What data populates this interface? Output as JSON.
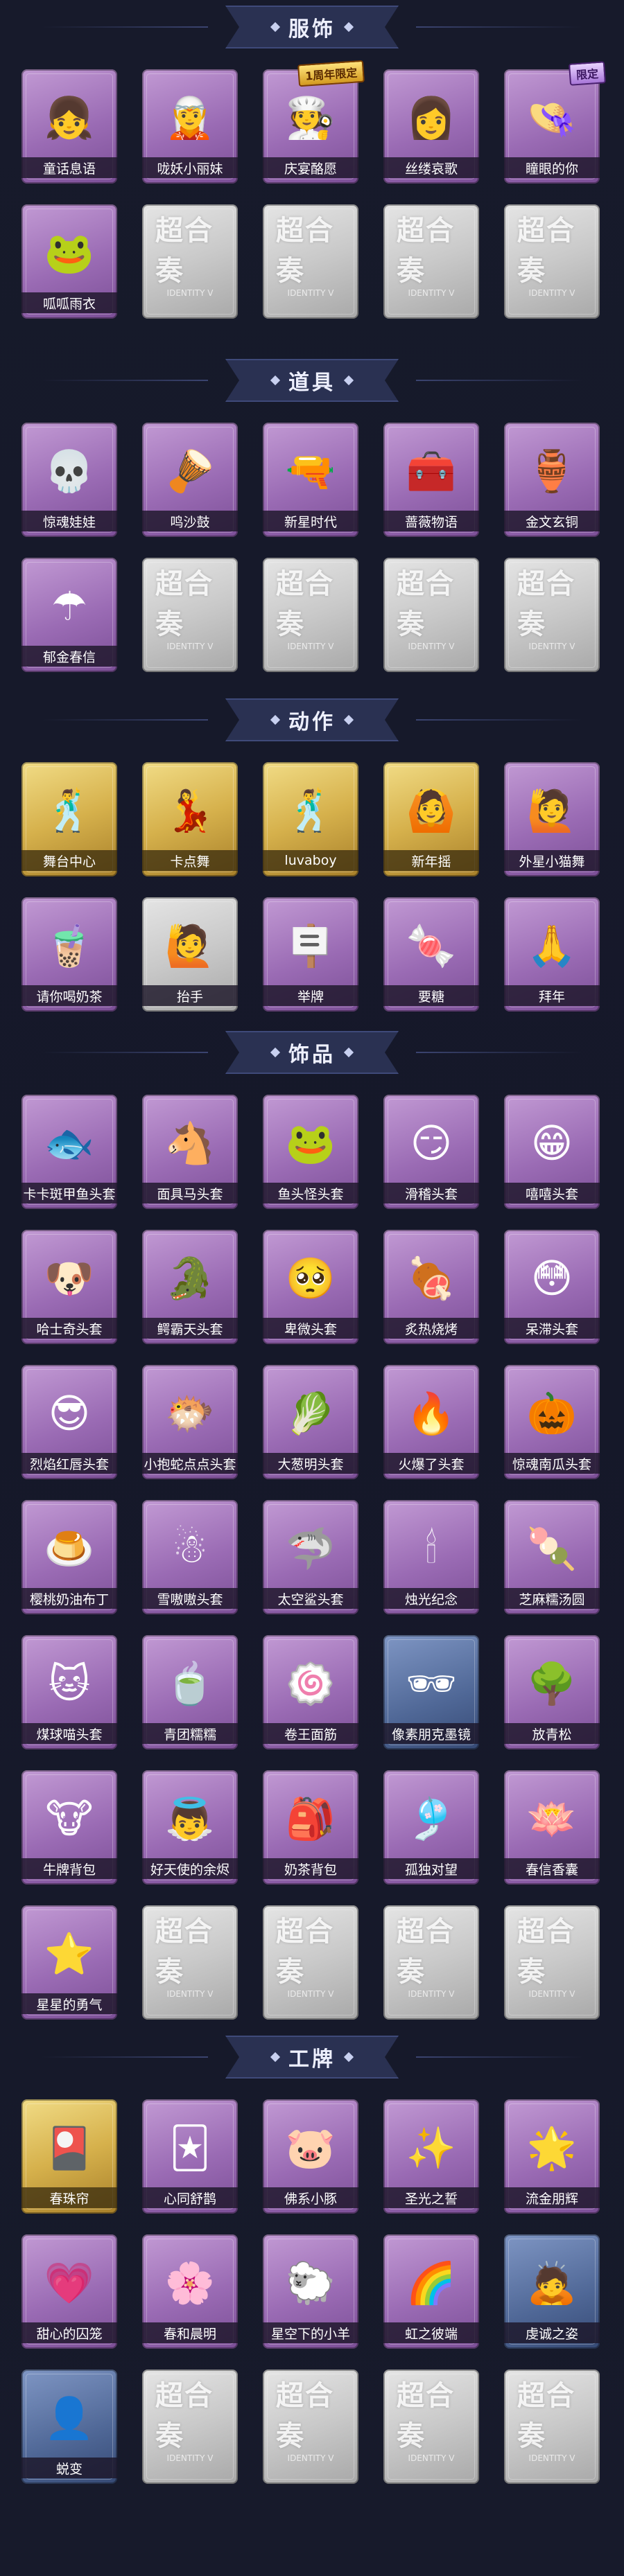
{
  "sections": [
    {
      "title": "服饰",
      "items": [
        {
          "label": "童话息语",
          "icon": "girl-avatar-icon",
          "style": "purple",
          "sym": "👧"
        },
        {
          "label": "咙妖小丽妹",
          "icon": "fox-girl-avatar-icon",
          "style": "purple",
          "sym": "🧝"
        },
        {
          "label": "庆宴酪愿",
          "icon": "chef-avatar-icon",
          "style": "purple",
          "sym": "🧑‍🍳",
          "tag": "1周年限定"
        },
        {
          "label": "丝缕哀歌",
          "icon": "lady-avatar-icon",
          "style": "purple",
          "sym": "👩"
        },
        {
          "label": "瞳眼的你",
          "icon": "hat-girl-avatar-icon",
          "style": "purple",
          "sym": "👒",
          "tag": "限定",
          "tagStyle": "purple"
        },
        {
          "label": "呱呱雨衣",
          "icon": "frog-raincoat-avatar-icon",
          "style": "purple",
          "sym": "🐸"
        },
        {
          "placeholder": true,
          "label": "超合奏",
          "sub": "IDENTITY V"
        },
        {
          "placeholder": true,
          "label": "超合奏",
          "sub": "IDENTITY V"
        },
        {
          "placeholder": true,
          "label": "超合奏",
          "sub": "IDENTITY V"
        },
        {
          "placeholder": true,
          "label": "超合奏",
          "sub": "IDENTITY V"
        }
      ]
    },
    {
      "title": "道具",
      "items": [
        {
          "label": "惊魂娃娃",
          "icon": "skull-doll-icon",
          "style": "purple",
          "sym": "💀"
        },
        {
          "label": "鸣沙鼓",
          "icon": "dreamcatcher-icon",
          "style": "purple",
          "sym": "🪘"
        },
        {
          "label": "新星时代",
          "icon": "pistol-icon",
          "style": "purple",
          "sym": "🔫"
        },
        {
          "label": "蔷薇物语",
          "icon": "medkit-icon",
          "style": "purple",
          "sym": "🧰"
        },
        {
          "label": "金文玄铜",
          "icon": "bronze-vessel-icon",
          "style": "purple",
          "sym": "🏺"
        },
        {
          "label": "郁金春信",
          "icon": "parasol-icon",
          "style": "purple",
          "sym": "☂"
        },
        {
          "placeholder": true,
          "label": "超合奏",
          "sub": "IDENTITY V"
        },
        {
          "placeholder": true,
          "label": "超合奏",
          "sub": "IDENTITY V"
        },
        {
          "placeholder": true,
          "label": "超合奏",
          "sub": "IDENTITY V"
        },
        {
          "placeholder": true,
          "label": "超合奏",
          "sub": "IDENTITY V"
        }
      ]
    },
    {
      "title": "动作",
      "items": [
        {
          "label": "舞台中心",
          "icon": "dance-pose-icon",
          "style": "gold",
          "sym": "🕺"
        },
        {
          "label": "卡点舞",
          "icon": "dance-pose-icon",
          "style": "gold",
          "sym": "💃"
        },
        {
          "label": "luvaboy",
          "icon": "dance-pose-icon",
          "style": "gold",
          "sym": "🕺"
        },
        {
          "label": "新年摇",
          "icon": "dance-pose-icon",
          "style": "gold",
          "sym": "🙆"
        },
        {
          "label": "外星小猫舞",
          "icon": "dance-pose-icon",
          "style": "purple",
          "sym": "🙋"
        },
        {
          "label": "请你喝奶茶",
          "icon": "bubble-tea-pose-icon",
          "style": "purple",
          "sym": "🧋"
        },
        {
          "label": "抬手",
          "icon": "raise-hand-pose-icon",
          "style": "grey",
          "sym": "🙋"
        },
        {
          "label": "举牌",
          "icon": "sign-pose-icon",
          "style": "purple",
          "sym": "🪧"
        },
        {
          "label": "要糖",
          "icon": "ask-candy-pose-icon",
          "style": "purple",
          "sym": "🍬"
        },
        {
          "label": "拜年",
          "icon": "greeting-pose-icon",
          "style": "purple",
          "sym": "🙏"
        }
      ]
    },
    {
      "title": "饰品",
      "items": [
        {
          "label": "卡卡斑甲鱼头套",
          "icon": "fish-head-icon",
          "style": "purple",
          "sym": "🐟"
        },
        {
          "label": "面具马头套",
          "icon": "horse-head-icon",
          "style": "purple",
          "sym": "🐴"
        },
        {
          "label": "鱼头怪头套",
          "icon": "fish-monster-head-icon",
          "style": "purple",
          "sym": "🐸"
        },
        {
          "label": "滑稽头套",
          "icon": "funny-face-icon",
          "style": "purple",
          "sym": "😏"
        },
        {
          "label": "嘻嘻头套",
          "icon": "grin-face-icon",
          "style": "purple",
          "sym": "😁"
        },
        {
          "label": "哈士奇头套",
          "icon": "husky-head-icon",
          "style": "purple",
          "sym": "🐶"
        },
        {
          "label": "鳄霸天头套",
          "icon": "crocodile-head-icon",
          "style": "purple",
          "sym": "🐊"
        },
        {
          "label": "卑微头套",
          "icon": "humble-face-icon",
          "style": "purple",
          "sym": "🥺"
        },
        {
          "label": "炙热烧烤",
          "icon": "bbq-meat-icon",
          "style": "purple",
          "sym": "🍖"
        },
        {
          "label": "呆滞头套",
          "icon": "dazed-face-icon",
          "style": "purple",
          "sym": "😳"
        },
        {
          "label": "烈焰红唇头套",
          "icon": "sunglasses-pikachu-icon",
          "style": "purple",
          "sym": "😎"
        },
        {
          "label": "小抱蛇点点头套",
          "icon": "pink-blob-icon",
          "style": "purple",
          "sym": "🐡"
        },
        {
          "label": "大葱明头套",
          "icon": "scallion-head-icon",
          "style": "purple",
          "sym": "🥬"
        },
        {
          "label": "火爆了头套",
          "icon": "fire-head-icon",
          "style": "purple",
          "sym": "🔥"
        },
        {
          "label": "惊魂南瓜头套",
          "icon": "pumpkin-head-icon",
          "style": "purple",
          "sym": "🎃"
        },
        {
          "label": "樱桃奶油布丁",
          "icon": "pudding-icon",
          "style": "purple",
          "sym": "🍮"
        },
        {
          "label": "雪嗷嗷头套",
          "icon": "snow-creature-icon",
          "style": "purple",
          "sym": "☃"
        },
        {
          "label": "太空鲨头套",
          "icon": "shark-head-icon",
          "style": "purple",
          "sym": "🦈"
        },
        {
          "label": "烛光纪念",
          "icon": "candle-icon",
          "style": "purple",
          "sym": "🕯"
        },
        {
          "label": "芝麻糯汤圆",
          "icon": "rice-ball-icon",
          "style": "purple",
          "sym": "🍡"
        },
        {
          "label": "煤球喵头套",
          "icon": "black-cat-head-icon",
          "style": "purple",
          "sym": "🐱"
        },
        {
          "label": "青团糯糯",
          "icon": "green-dumpling-icon",
          "style": "purple",
          "sym": "🍵"
        },
        {
          "label": "卷王面筋",
          "icon": "swiss-roll-icon",
          "style": "purple",
          "sym": "🍥"
        },
        {
          "label": "像素朋克墨镜",
          "icon": "pixel-sunglasses-icon",
          "style": "navy",
          "sym": "🕶"
        },
        {
          "label": "放青松",
          "icon": "bonsai-icon",
          "style": "purple",
          "sym": "🌳"
        },
        {
          "label": "牛牌背包",
          "icon": "cow-backpack-icon",
          "style": "purple",
          "sym": "🐮"
        },
        {
          "label": "好天使的余烬",
          "icon": "angel-doll-icon",
          "style": "purple",
          "sym": "👼"
        },
        {
          "label": "奶茶背包",
          "icon": "milktea-backpack-icon",
          "style": "purple",
          "sym": "🎒"
        },
        {
          "label": "孤独对望",
          "icon": "hanging-charm-icon",
          "style": "purple",
          "sym": "🎐"
        },
        {
          "label": "春信香囊",
          "icon": "sachet-icon",
          "style": "purple",
          "sym": "🪷"
        },
        {
          "label": "星星的勇气",
          "icon": "star-doll-icon",
          "style": "purple",
          "sym": "⭐"
        },
        {
          "placeholder": true,
          "label": "超合奏",
          "sub": "IDENTITY V"
        },
        {
          "placeholder": true,
          "label": "超合奏",
          "sub": "IDENTITY V"
        },
        {
          "placeholder": true,
          "label": "超合奏",
          "sub": "IDENTITY V"
        },
        {
          "placeholder": true,
          "label": "超合奏",
          "sub": "IDENTITY V"
        }
      ]
    },
    {
      "title": "工牌",
      "items": [
        {
          "label": "春珠帘",
          "icon": "badge-card-icon",
          "style": "gold",
          "sym": "🎴"
        },
        {
          "label": "心同舒鹊",
          "icon": "badge-card-icon",
          "style": "purple",
          "sym": "🃏"
        },
        {
          "label": "佛系小豚",
          "icon": "badge-card-icon",
          "style": "purple",
          "sym": "🐷"
        },
        {
          "label": "圣光之誓",
          "icon": "badge-card-icon",
          "style": "purple",
          "sym": "✨"
        },
        {
          "label": "流金朋辉",
          "icon": "badge-card-icon",
          "style": "purple",
          "sym": "🌟"
        },
        {
          "label": "甜心的囚笼",
          "icon": "badge-card-icon",
          "style": "purple",
          "sym": "💗"
        },
        {
          "label": "春和晨明",
          "icon": "badge-card-icon",
          "style": "purple",
          "sym": "🌸"
        },
        {
          "label": "星空下的小羊",
          "icon": "badge-card-icon",
          "style": "purple",
          "sym": "🐑"
        },
        {
          "label": "虹之彼端",
          "icon": "badge-card-icon",
          "style": "purple",
          "sym": "🌈"
        },
        {
          "label": "虔诚之姿",
          "icon": "badge-card-icon",
          "style": "navy",
          "sym": "🙇"
        },
        {
          "label": "蜕变",
          "icon": "badge-card-icon",
          "style": "navy",
          "sym": "👤"
        },
        {
          "placeholder": true,
          "label": "超合奏",
          "sub": "IDENTITY V"
        },
        {
          "placeholder": true,
          "label": "超合奏",
          "sub": "IDENTITY V"
        },
        {
          "placeholder": true,
          "label": "超合奏",
          "sub": "IDENTITY V"
        },
        {
          "placeholder": true,
          "label": "超合奏",
          "sub": "IDENTITY V"
        }
      ]
    }
  ]
}
